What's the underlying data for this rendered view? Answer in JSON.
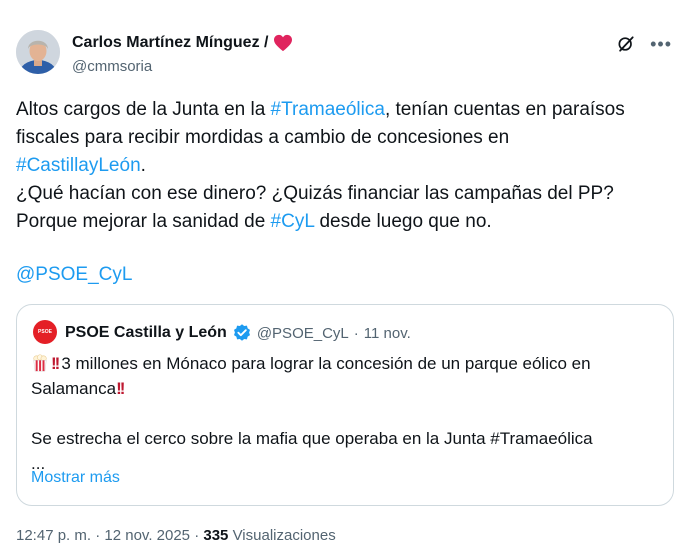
{
  "tweet": {
    "author": {
      "name": "Carlos Martínez Mínguez /",
      "handle": "@cmmsoria"
    },
    "body": {
      "l1_a": "Altos cargos de la Junta en la ",
      "l1_tag": "#Tramaeólica",
      "l1_b": ", tenían cuentas en paraísos",
      "l2": "fiscales para recibir mordidas a cambio de concesiones en",
      "l3_tag": "#CastillayLeón",
      "l3_b": ".",
      "l4": "¿Qué hacían con ese dinero? ¿Quizás financiar las campañas del PP?",
      "l5_a": "Porque mejorar la sanidad de ",
      "l5_tag": "#CyL",
      "l5_b": " desde luego que no.",
      "mention": "@PSOE_CyL"
    },
    "quote": {
      "avatar_text": "PSOE",
      "name": "PSOE Castilla y León",
      "handle": "@PSOE_CyL",
      "separator": "·",
      "date": "11 nov.",
      "l1": "3 millones en Mónaco para lograr la concesión de un parque eólico en",
      "l2": "Salamanca",
      "l3": "Se estrecha el cerco sobre la mafia que operaba en la Junta #Tramaeólica",
      "ellipsis": "...",
      "show_more": "Mostrar más"
    },
    "meta": {
      "time": "12:47 p. m.",
      "sep": " · ",
      "date": "12 nov. 2025",
      "sep2": " · ",
      "views": "335",
      "views_label": " Visualizaciones"
    },
    "icons": {
      "heart": "red-heart-icon",
      "grok": "grok-icon",
      "more": "more-icon",
      "verified": "verified-badge-icon",
      "popcorn": "popcorn-icon",
      "double_exclamation": "double-exclamation-icon"
    },
    "colors": {
      "link": "#1d9bf0",
      "text": "#0f1419",
      "secondary": "#536471",
      "heart": "#e0245e",
      "psoe": "#e41f26"
    }
  }
}
